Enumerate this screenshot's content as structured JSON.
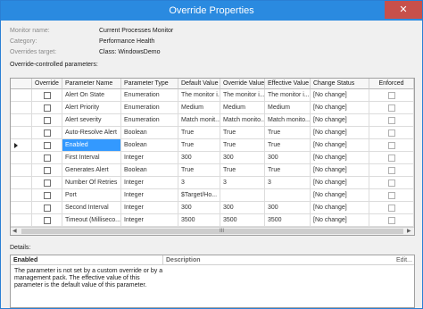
{
  "window": {
    "title": "Override Properties",
    "close_label": "✕"
  },
  "info": [
    {
      "label": "Monitor name:",
      "value": "Current Processes Monitor"
    },
    {
      "label": "Category:",
      "value": "Performance Health"
    },
    {
      "label": "Overrides target:",
      "value": "Class: WindowsDemo"
    }
  ],
  "grid": {
    "section_label": "Override-controlled parameters:",
    "columns": [
      "Override",
      "Parameter Name",
      "Parameter Type",
      "Default Value",
      "Override Value",
      "Effective Value",
      "Change Status",
      "Enforced"
    ],
    "rows": [
      {
        "name": "Alert On State",
        "type": "Enumeration",
        "default": "The monitor i...",
        "override": "The monitor i...",
        "effective": "The monitor i...",
        "status": "[No change]",
        "selected": false
      },
      {
        "name": "Alert Priority",
        "type": "Enumeration",
        "default": "Medium",
        "override": "Medium",
        "effective": "Medium",
        "status": "[No change]",
        "selected": false
      },
      {
        "name": "Alert severity",
        "type": "Enumeration",
        "default": "Match monit...",
        "override": "Match monito...",
        "effective": "Match monito...",
        "status": "[No change]",
        "selected": false
      },
      {
        "name": "Auto-Resolve Alert",
        "type": "Boolean",
        "default": "True",
        "override": "True",
        "effective": "True",
        "status": "[No change]",
        "selected": false
      },
      {
        "name": "Enabled",
        "type": "Boolean",
        "default": "True",
        "override": "True",
        "effective": "True",
        "status": "[No change]",
        "selected": true
      },
      {
        "name": "First Interval",
        "type": "Integer",
        "default": "300",
        "override": "300",
        "effective": "300",
        "status": "[No change]",
        "selected": false
      },
      {
        "name": "Generates Alert",
        "type": "Boolean",
        "default": "True",
        "override": "True",
        "effective": "True",
        "status": "[No change]",
        "selected": false
      },
      {
        "name": "Number Of Retries",
        "type": "Integer",
        "default": "3",
        "override": "3",
        "effective": "3",
        "status": "[No change]",
        "selected": false
      },
      {
        "name": "Port",
        "type": "Integer",
        "default": "$Target/Ho...",
        "override": "",
        "effective": "",
        "status": "[No change]",
        "selected": false
      },
      {
        "name": "Second Interval",
        "type": "Integer",
        "default": "300",
        "override": "300",
        "effective": "300",
        "status": "[No change]",
        "selected": false
      },
      {
        "name": "Timeout (Milliseco...",
        "type": "Integer",
        "default": "3500",
        "override": "3500",
        "effective": "3500",
        "status": "[No change]",
        "selected": false
      }
    ],
    "scroll_grip": "III"
  },
  "details": {
    "label": "Details:",
    "selected_name": "Enabled",
    "description_header": "Description",
    "edit_label": "Edit...",
    "description_text": "The parameter is not set by a custom override or by a management pack. The effective value of this parameter is the default value of this parameter."
  },
  "colors": {
    "titlebar": "#2a8ae0",
    "selection": "#3399ff",
    "close": "#c7504b"
  }
}
